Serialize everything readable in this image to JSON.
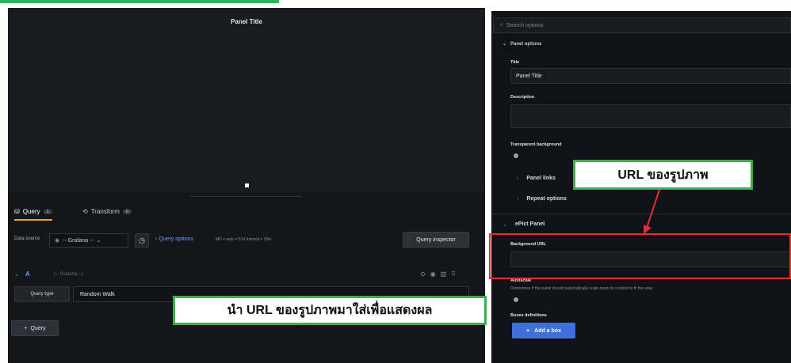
{
  "panel": {
    "title": "Panel Title"
  },
  "query_tabs": [
    {
      "label": "Query",
      "count": "1"
    },
    {
      "label": "Transform",
      "count": "0"
    }
  ],
  "datasource": {
    "label": "Data source",
    "value": "-- Grafana --",
    "query_options": "Query options",
    "query_options_detail": "MD = auto = 514   Interval = 20m",
    "query_inspector": "Query inspector"
  },
  "query_row": {
    "letter": "A",
    "datasource": "(-- Grafana --)",
    "query_type_label": "Query type",
    "query_type_value": "Random Walk"
  },
  "add_query": "Query",
  "callouts": {
    "left": "นำ URL ของรูปภาพมาใส่เพื่อแสดงผล",
    "right": "URL ของรูปภาพ"
  },
  "options": {
    "search_placeholder": "Search options",
    "panel_options_header": "Panel options",
    "title_label": "Title",
    "title_value": "Panel Title",
    "description_label": "Description",
    "transparent_label": "Transparent background",
    "panel_links": "Panel links",
    "repeat_options": "Repeat options",
    "epict_header": "ePict Panel",
    "background_url_label": "Background URL",
    "autoscale_label": "Autoscale",
    "autoscale_desc": "Determines if the panel should automatically scale down its content to fit the view",
    "boxes_label": "Boxes definitions",
    "add_box": "Add a box"
  },
  "colors": {
    "accent_blue": "#3d71d9",
    "highlight_red": "#e03030",
    "callout_green": "#3fae4a"
  }
}
